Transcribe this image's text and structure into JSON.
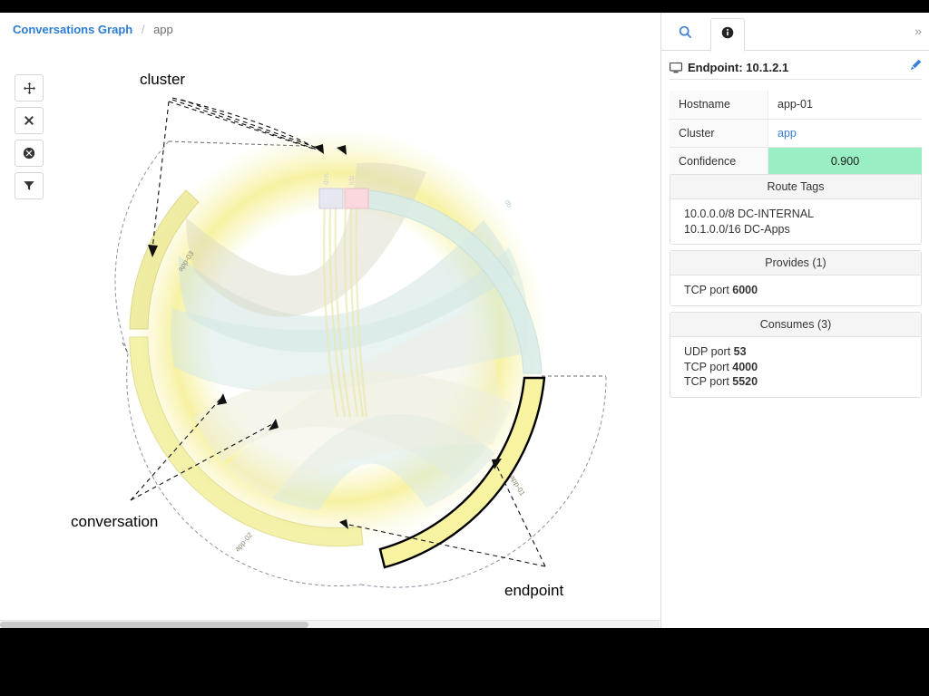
{
  "breadcrumb": {
    "root": "Conversations Graph",
    "separator": "/",
    "current": "app"
  },
  "toolbar": {
    "items": [
      {
        "name": "pan-tool",
        "icon": "arrows-move-icon",
        "label": "Pan"
      },
      {
        "name": "close-tool",
        "icon": "close-icon",
        "label": "Close"
      },
      {
        "name": "reset-tool",
        "icon": "circle-x-icon",
        "label": "Reset"
      },
      {
        "name": "filter-tool",
        "icon": "funnel-icon",
        "label": "Filter"
      }
    ]
  },
  "graph": {
    "annotations": [
      {
        "label": "cluster"
      },
      {
        "label": "conversation"
      },
      {
        "label": "endpoint"
      }
    ],
    "arc_labels": {
      "app01": "app-01",
      "app02": "app-02",
      "app03": "app-03",
      "db": "db",
      "tiny_left": "dns",
      "tiny_right": "ldp"
    },
    "colors": {
      "cluster_yellow": "#f3f2a8",
      "endpoint_yellow": "#f7f3a0",
      "teal": "#cfe8e4",
      "pink": "#f7d4da",
      "lavender": "#e4e4ee",
      "selected_outline": "#000000"
    }
  },
  "info_panel": {
    "tabs": [
      {
        "name": "tab-search",
        "icon": "search-icon",
        "active": false
      },
      {
        "name": "tab-info",
        "icon": "info-icon",
        "active": true
      }
    ],
    "expand_glyph": "»",
    "endpoint": {
      "icon": "monitor-icon",
      "title": "Endpoint: 10.1.2.1",
      "edit_icon": "pencil-icon"
    },
    "properties": [
      {
        "key": "Hostname",
        "value": "app-01",
        "style": "text"
      },
      {
        "key": "Cluster",
        "value": "app",
        "style": "link"
      },
      {
        "key": "Confidence",
        "value": "0.900",
        "style": "highlight"
      }
    ],
    "route_tags": {
      "title": "Route Tags",
      "items": [
        "10.0.0.0/8 DC-INTERNAL",
        "10.1.0.0/16 DC-Apps"
      ]
    },
    "provides": {
      "title": "Provides (1)",
      "items": [
        {
          "proto": "TCP port ",
          "port": "6000"
        }
      ]
    },
    "consumes": {
      "title": "Consumes (3)",
      "items": [
        {
          "proto": "UDP port ",
          "port": "53"
        },
        {
          "proto": "TCP port ",
          "port": "4000"
        },
        {
          "proto": "TCP port ",
          "port": "5520"
        }
      ]
    }
  }
}
